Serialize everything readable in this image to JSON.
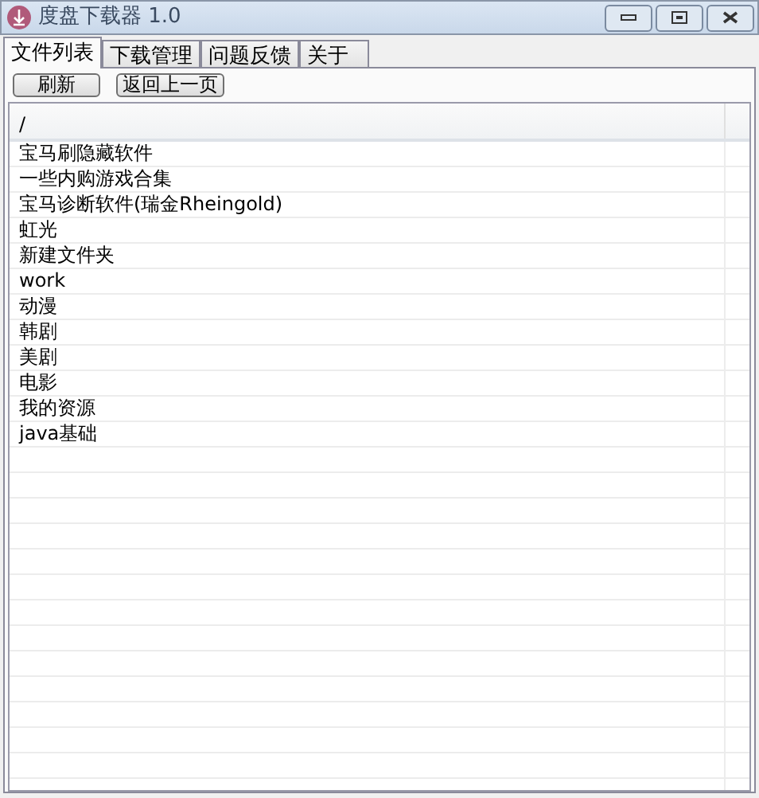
{
  "window": {
    "title": "度盘下载器 1.0"
  },
  "tabs": [
    {
      "label": "文件列表",
      "selected": true
    },
    {
      "label": "下载管理",
      "selected": false
    },
    {
      "label": "问题反馈",
      "selected": false
    },
    {
      "label": "关于",
      "selected": false
    }
  ],
  "buttons": [
    "刷新",
    "返回上一页"
  ],
  "table": {
    "path": "/",
    "rows": [
      "宝马刷隐藏软件",
      "一些内购游戏合集",
      "宝马诊断软件(瑞金Rheingold)",
      "虹光",
      "新建文件夹",
      "work",
      "动漫",
      "韩剧",
      "美剧",
      "电影",
      "我的资源",
      "java基础"
    ]
  }
}
